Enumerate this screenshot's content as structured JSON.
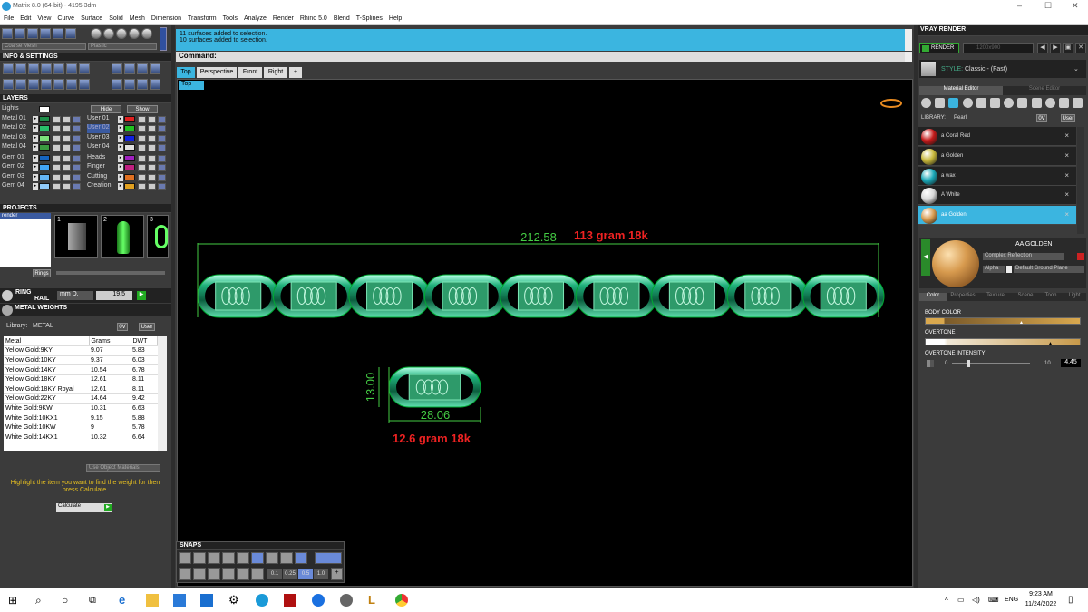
{
  "window": {
    "title": "Matrix 8.0 (64-bit) - 4195.3dm",
    "min": "–",
    "max": "☐",
    "close": "✕"
  },
  "menu": [
    "File",
    "Edit",
    "View",
    "Curve",
    "Surface",
    "Solid",
    "Mesh",
    "Dimension",
    "Transform",
    "Tools",
    "Analyze",
    "Render",
    "Rhino 5.0",
    "Blend",
    "T-Splines",
    "Help"
  ],
  "toolbar": {
    "mesh_quality": "Coarse Mesh",
    "material": "Plastic"
  },
  "info_settings": {
    "title": "INFO & SETTINGS"
  },
  "layers": {
    "title": "LAYERS",
    "lights_label": "Lights",
    "hide_label": "Hide",
    "show_label": "Show",
    "metal": [
      {
        "name": "Metal 01",
        "color": "#1f8f4a"
      },
      {
        "name": "Metal 02",
        "color": "#29c06a"
      },
      {
        "name": "Metal 03",
        "color": "#7be07b"
      },
      {
        "name": "Metal 04",
        "color": "#3a9a40"
      }
    ],
    "user": [
      {
        "name": "User 01",
        "color": "#e02020"
      },
      {
        "name": "User 02",
        "color": "#20c020"
      },
      {
        "name": "User 03",
        "color": "#1020e0"
      },
      {
        "name": "User 04",
        "color": "#e0e0e0"
      }
    ],
    "gem": [
      {
        "name": "Gem 01",
        "color": "#1565c0"
      },
      {
        "name": "Gem 02",
        "color": "#42a5f5"
      },
      {
        "name": "Gem 03",
        "color": "#64b5f6"
      },
      {
        "name": "Gem 04",
        "color": "#90caf9"
      }
    ],
    "misc": [
      {
        "name": "Heads",
        "color": "#a020c0"
      },
      {
        "name": "Finger",
        "color": "#c02080"
      },
      {
        "name": "Cutting",
        "color": "#e07020"
      },
      {
        "name": "Creation",
        "color": "#e0a020"
      }
    ]
  },
  "projects": {
    "title": "PROJECTS",
    "item": "render",
    "thumbs": [
      "1",
      "2",
      "3"
    ],
    "ring_btn": "Rings"
  },
  "ring_rail": {
    "label_ring": "RING",
    "label_rail": "RAIL",
    "unit": "mm D.",
    "value": "19.5"
  },
  "metal_weights": {
    "title": "METAL WEIGHTS",
    "library_label": "Library:",
    "library_value": "METAL",
    "flag": "0V",
    "user": "User",
    "columns": [
      "Metal",
      "Grams",
      "DWT"
    ],
    "rows": [
      [
        "Yellow Gold:9KY",
        "9.07",
        "5.83"
      ],
      [
        "Yellow Gold:10KY",
        "9.37",
        "6.03"
      ],
      [
        "Yellow Gold:14KY",
        "10.54",
        "6.78"
      ],
      [
        "Yellow Gold:18KY",
        "12.61",
        "8.11"
      ],
      [
        "Yellow Gold:18KY Royal",
        "12.61",
        "8.11"
      ],
      [
        "Yellow Gold:22KY",
        "14.64",
        "9.42"
      ],
      [
        "White Gold:9KW",
        "10.31",
        "6.63"
      ],
      [
        "White Gold:10KX1",
        "9.15",
        "5.88"
      ],
      [
        "White Gold:10KW",
        "9",
        "5.78"
      ],
      [
        "White Gold:14KX1",
        "10.32",
        "6.64"
      ]
    ],
    "use_object_materials": "Use Object Materials",
    "hint": "Highlight the item you want to find the weight for then press Calculate.",
    "calculate": "Calculate"
  },
  "command": {
    "history": [
      "11 surfaces added to selection.",
      "10 surfaces added to selection."
    ],
    "label": "Command:"
  },
  "viewport_tabs": [
    "Top",
    "Perspective",
    "Front",
    "Right"
  ],
  "viewport": {
    "name": "Top",
    "dim_width": "212.58",
    "weight_chain": "113 gram 18k",
    "dim_link_height": "13.00",
    "dim_link_width": "28.06",
    "weight_link": "12.6 gram 18k"
  },
  "snaps": {
    "title": "SNAPS",
    "values": [
      "0.1",
      "0.25",
      "0.5",
      "1.0"
    ]
  },
  "vray": {
    "title": "VRAY RENDER",
    "render_btn": "RENDER",
    "resolution": "1200x900",
    "style_label": "STYLE:",
    "style_value": "Classic - (Fast)",
    "tabs": [
      "Material Editor",
      "Scene Editor"
    ],
    "library_label": "LIBRARY:",
    "library_value": "Pearl",
    "flag": "0V",
    "user": "User",
    "materials": [
      {
        "name": "a Coral Red",
        "color": "#c41a1a"
      },
      {
        "name": "a Golden",
        "color": "#c8b83a"
      },
      {
        "name": "a wax",
        "color": "#1aa8b8"
      },
      {
        "name": "A White",
        "color": "#d8d8d8"
      },
      {
        "name": "aa Golden",
        "color": "#d79a4e"
      }
    ],
    "selected_name": "AA  GOLDEN",
    "reflection": "Complex Reflection",
    "alpha": "Alpha",
    "ground": "Default Ground Plane",
    "prop_tabs": [
      "Color",
      "Properties",
      "Texture",
      "Scene",
      "Toon",
      "Light"
    ],
    "body_color": "BODY COLOR",
    "overtone": "OVERTONE",
    "overtone_intensity": "OVERTONE INTENSITY",
    "intensity_min": "0",
    "intensity_max": "10",
    "intensity_value": "4.45",
    "body_color_hex": "#d9a84e"
  },
  "taskbar": {
    "time": "9:23 AM",
    "date": "11/24/2022",
    "lang": "ENG"
  }
}
